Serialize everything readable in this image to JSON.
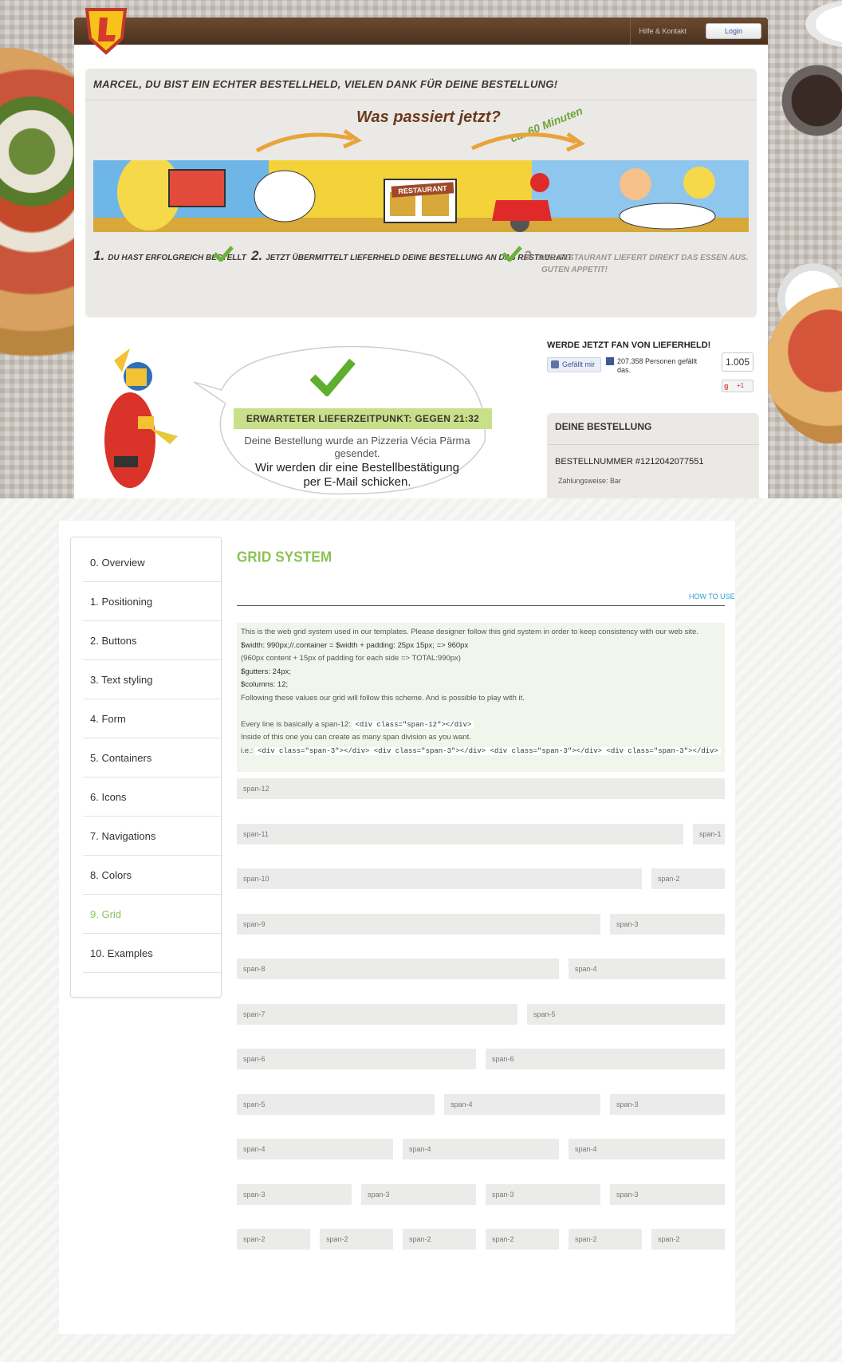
{
  "order_page": {
    "header": {
      "help_link": "Hilfe & Kontakt",
      "login": "Login"
    },
    "thanks_heading": "MARCEL, DU BIST EIN ECHTER BESTELLHELD, VIELEN DANK FÜR DEINE BESTELLUNG!",
    "infographic": {
      "question": "Was passiert jetzt?",
      "time_hint": "ca. 60 Minuten",
      "restaurant_sign": "RESTAURANT",
      "steps": [
        {
          "num": "1.",
          "text": "Du hast erfolgreich bestellt"
        },
        {
          "num": "2.",
          "text": "Jetzt übermittelt Lieferheld deine Bestellung an das Restaurant"
        },
        {
          "num": "3.",
          "text": "Das Restaurant liefert direkt das Essen aus.",
          "text2": "Guten Appetit!"
        }
      ]
    },
    "confirmation": {
      "delivery_time": "ERWARTETER LIEFERZEITPUNKT: GEGEN 21:32",
      "sent_line1": "Deine Bestellung wurde an Pizzeria Vécia Pärma",
      "sent_line2": "gesendet.",
      "email_line1": "Wir werden dir eine Bestellbestätigung",
      "email_line2": "per E-Mail schicken."
    },
    "social": {
      "fan_title": "WERDE JETZT FAN VON LIEFERHELD!",
      "like_button": "Gefällt mir",
      "like_text": "207.358 Personen gefällt das.",
      "like_count": "1.005",
      "gplus": "+1"
    },
    "order": {
      "title": "DEINE BESTELLUNG",
      "number": "BESTELLNUMMER #1212042077551",
      "payment": "Zahlungsweise: Bar"
    }
  },
  "styleguide": {
    "nav": [
      {
        "label": "0. Overview",
        "active": false
      },
      {
        "label": "1. Positioning",
        "active": false
      },
      {
        "label": "2. Buttons",
        "active": false
      },
      {
        "label": "3. Text styling",
        "active": false
      },
      {
        "label": "4. Form",
        "active": false
      },
      {
        "label": "5. Containers",
        "active": false
      },
      {
        "label": "6. Icons",
        "active": false
      },
      {
        "label": "7. Navigations",
        "active": false
      },
      {
        "label": "8. Colors",
        "active": false
      },
      {
        "label": "9. Grid",
        "active": true
      },
      {
        "label": "10. Examples",
        "active": false
      }
    ],
    "title": "GRID SYSTEM",
    "how_to_use": "HOW TO USE",
    "info": {
      "line1": "This is the web grid system used in our templates. Please designer follow this grid system in order to keep consistency with our web site.",
      "line2": "$width: 990px;//.container = $width + padding: 25px 15px; => 960px",
      "line3": "(960px content + 15px of padding for each side => TOTAL:990px)",
      "line4": "$gutters: 24px;",
      "line5": "$columns: 12;",
      "line6": "Following these values our grid will follow this scheme. And is possible to play with it.",
      "line7_prefix": "Every line is basically a span-12:",
      "line7_code": "<div class=\"span-12\"></div>",
      "line8": "Inside of this one you can create as many span division as you want.",
      "line9_prefix": "i.e.:",
      "line9_code": "<div class=\"span-3\"></div> <div class=\"span-3\"></div> <div class=\"span-3\"></div> <div class=\"span-3\"></div>"
    },
    "grid_rows": [
      [
        "span-12"
      ],
      [
        "span-11",
        "span-1"
      ],
      [
        "span-10",
        "span-2"
      ],
      [
        "span-9",
        "span-3"
      ],
      [
        "span-8",
        "span-4"
      ],
      [
        "span-7",
        "span-5"
      ],
      [
        "span-6",
        "span-6"
      ],
      [
        "span-5",
        "span-4",
        "span-3"
      ],
      [
        "span-4",
        "span-4",
        "span-4"
      ],
      [
        "span-3",
        "span-3",
        "span-3",
        "span-3"
      ],
      [
        "span-2",
        "span-2",
        "span-2",
        "span-2",
        "span-2",
        "span-2"
      ]
    ],
    "colors": {
      "accent": "#8cc152",
      "link": "#2f9fd0",
      "info_bg": "#f0f6ec",
      "cell_bg": "#ebebea"
    }
  }
}
